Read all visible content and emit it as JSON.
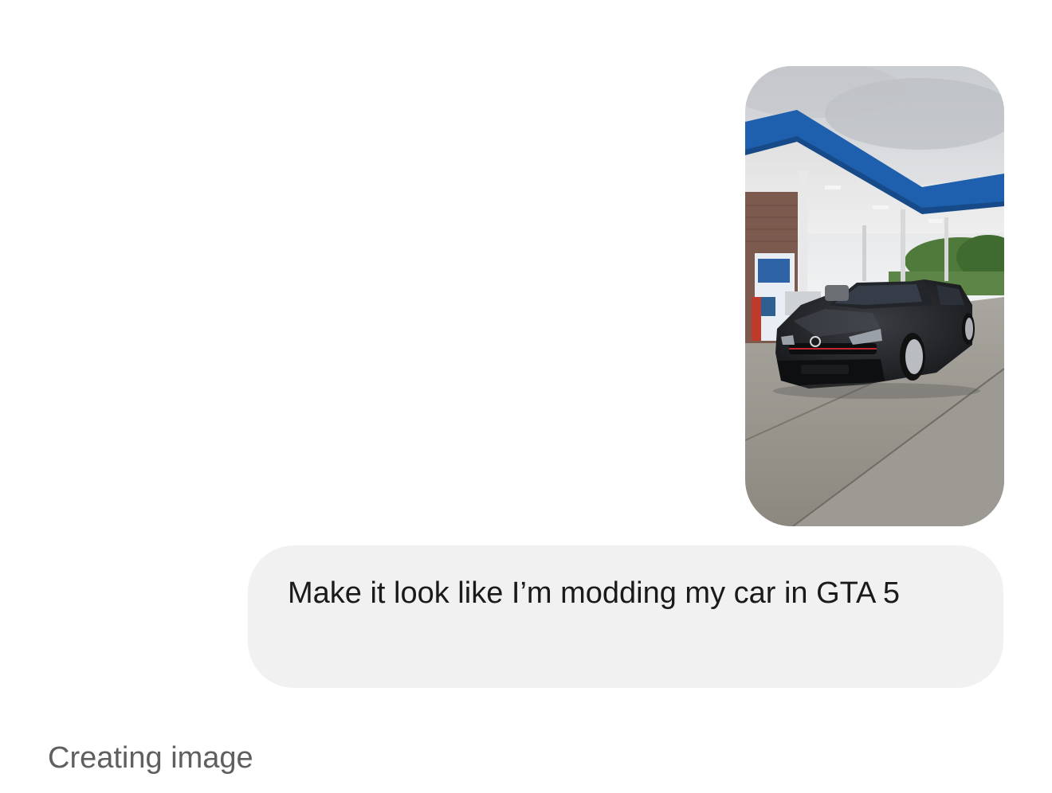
{
  "chat": {
    "attachment": {
      "kind": "photo",
      "description_icon": "attached-photo-thumbnail"
    },
    "user_message": {
      "text": "Make it look like I’m modding my car in GTA 5"
    },
    "assistant_status": {
      "text": "Creating image"
    }
  },
  "colors": {
    "background": "#ffffff",
    "bubble": "#f1f1f1",
    "message_text": "#1a1a1a",
    "status_text": "#5f5f5f",
    "canopy_blue": "#1e5fae"
  }
}
